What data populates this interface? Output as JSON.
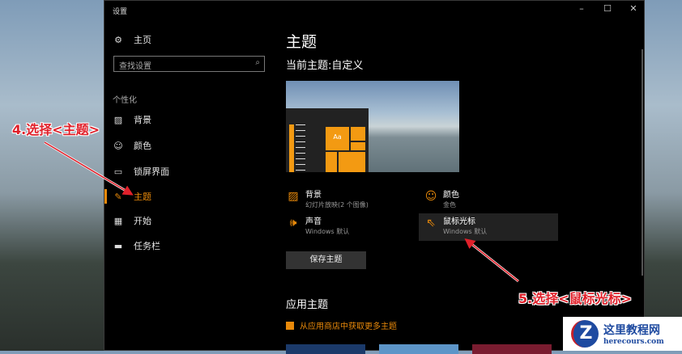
{
  "window": {
    "title": "设置",
    "minimize": "–",
    "maximize": "☐",
    "close": "✕"
  },
  "sidebar": {
    "home": "主页",
    "search_placeholder": "查找设置",
    "section": "个性化",
    "items": [
      {
        "label": "背景",
        "icon": "▨"
      },
      {
        "label": "颜色",
        "icon": "☺"
      },
      {
        "label": "锁屏界面",
        "icon": "▭"
      },
      {
        "label": "主题",
        "icon": "✎"
      },
      {
        "label": "开始",
        "icon": "▦"
      },
      {
        "label": "任务栏",
        "icon": "▬"
      }
    ]
  },
  "main": {
    "title": "主题",
    "current": "当前主题:自定义",
    "preview_tile": "Aa",
    "options": [
      {
        "title": "背景",
        "sub": "幻灯片放映(2 个图像)"
      },
      {
        "title": "颜色",
        "sub": "金色"
      },
      {
        "title": "声音",
        "sub": "Windows 默认"
      },
      {
        "title": "鼠标光标",
        "sub": "Windows 默认"
      }
    ],
    "save_button": "保存主题",
    "apply_heading": "应用主题",
    "store_link": "从应用商店中获取更多主题"
  },
  "annotations": {
    "step4": "4.选择<主题>",
    "step5": "5.选择<鼠标光标>"
  },
  "watermark": {
    "name": "这里教程网",
    "url": "herecours.com",
    "mark": "Z"
  },
  "colors": {
    "accent": "#e8890a",
    "annotation": "#e0202a"
  }
}
